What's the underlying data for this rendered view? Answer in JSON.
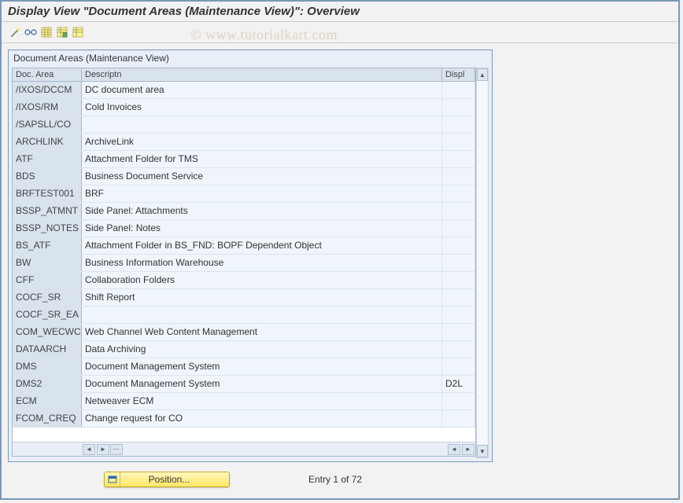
{
  "title": "Display View \"Document Areas (Maintenance View)\": Overview",
  "watermark": "© www.tutorialkart.com",
  "contentTitle": "Document Areas (Maintenance View)",
  "columns": {
    "doc": "Doc. Area",
    "desc": "Descriptn",
    "disp": "Displ"
  },
  "rows": [
    {
      "doc": "/IXOS/DCCM",
      "desc": "DC document area",
      "disp": ""
    },
    {
      "doc": "/IXOS/RM",
      "desc": "Cold Invoices",
      "disp": ""
    },
    {
      "doc": "/SAPSLL/CO",
      "desc": "",
      "disp": ""
    },
    {
      "doc": "ARCHLINK",
      "desc": "ArchiveLink",
      "disp": ""
    },
    {
      "doc": "ATF",
      "desc": "Attachment Folder for TMS",
      "disp": ""
    },
    {
      "doc": "BDS",
      "desc": "Business Document Service",
      "disp": ""
    },
    {
      "doc": "BRFTEST001",
      "desc": "BRF",
      "disp": ""
    },
    {
      "doc": "BSSP_ATMNT",
      "desc": "Side Panel: Attachments",
      "disp": ""
    },
    {
      "doc": "BSSP_NOTES",
      "desc": "Side Panel: Notes",
      "disp": ""
    },
    {
      "doc": "BS_ATF",
      "desc": "Attachment Folder in BS_FND: BOPF Dependent Object",
      "disp": ""
    },
    {
      "doc": "BW",
      "desc": "Business Information Warehouse",
      "disp": ""
    },
    {
      "doc": "CFF",
      "desc": "Collaboration Folders",
      "disp": ""
    },
    {
      "doc": "COCF_SR",
      "desc": "Shift Report",
      "disp": ""
    },
    {
      "doc": "COCF_SR_EA",
      "desc": "",
      "disp": ""
    },
    {
      "doc": "COM_WECWCM",
      "desc": "Web Channel Web Content Management",
      "disp": ""
    },
    {
      "doc": "DATAARCH",
      "desc": "Data Archiving",
      "disp": ""
    },
    {
      "doc": "DMS",
      "desc": "Document Management System",
      "disp": ""
    },
    {
      "doc": "DMS2",
      "desc": "Document Management System",
      "disp": "D2L"
    },
    {
      "doc": "ECM",
      "desc": "Netweaver ECM",
      "disp": ""
    },
    {
      "doc": "FCOM_CREQ",
      "desc": "Change request for CO",
      "disp": ""
    }
  ],
  "footer": {
    "positionLabel": "Position...",
    "entryText": "Entry 1 of 72"
  },
  "toolbar": {
    "icons": [
      "wand-icon",
      "glasses-icon",
      "table-icon",
      "table-save-icon",
      "table-view-icon"
    ]
  }
}
